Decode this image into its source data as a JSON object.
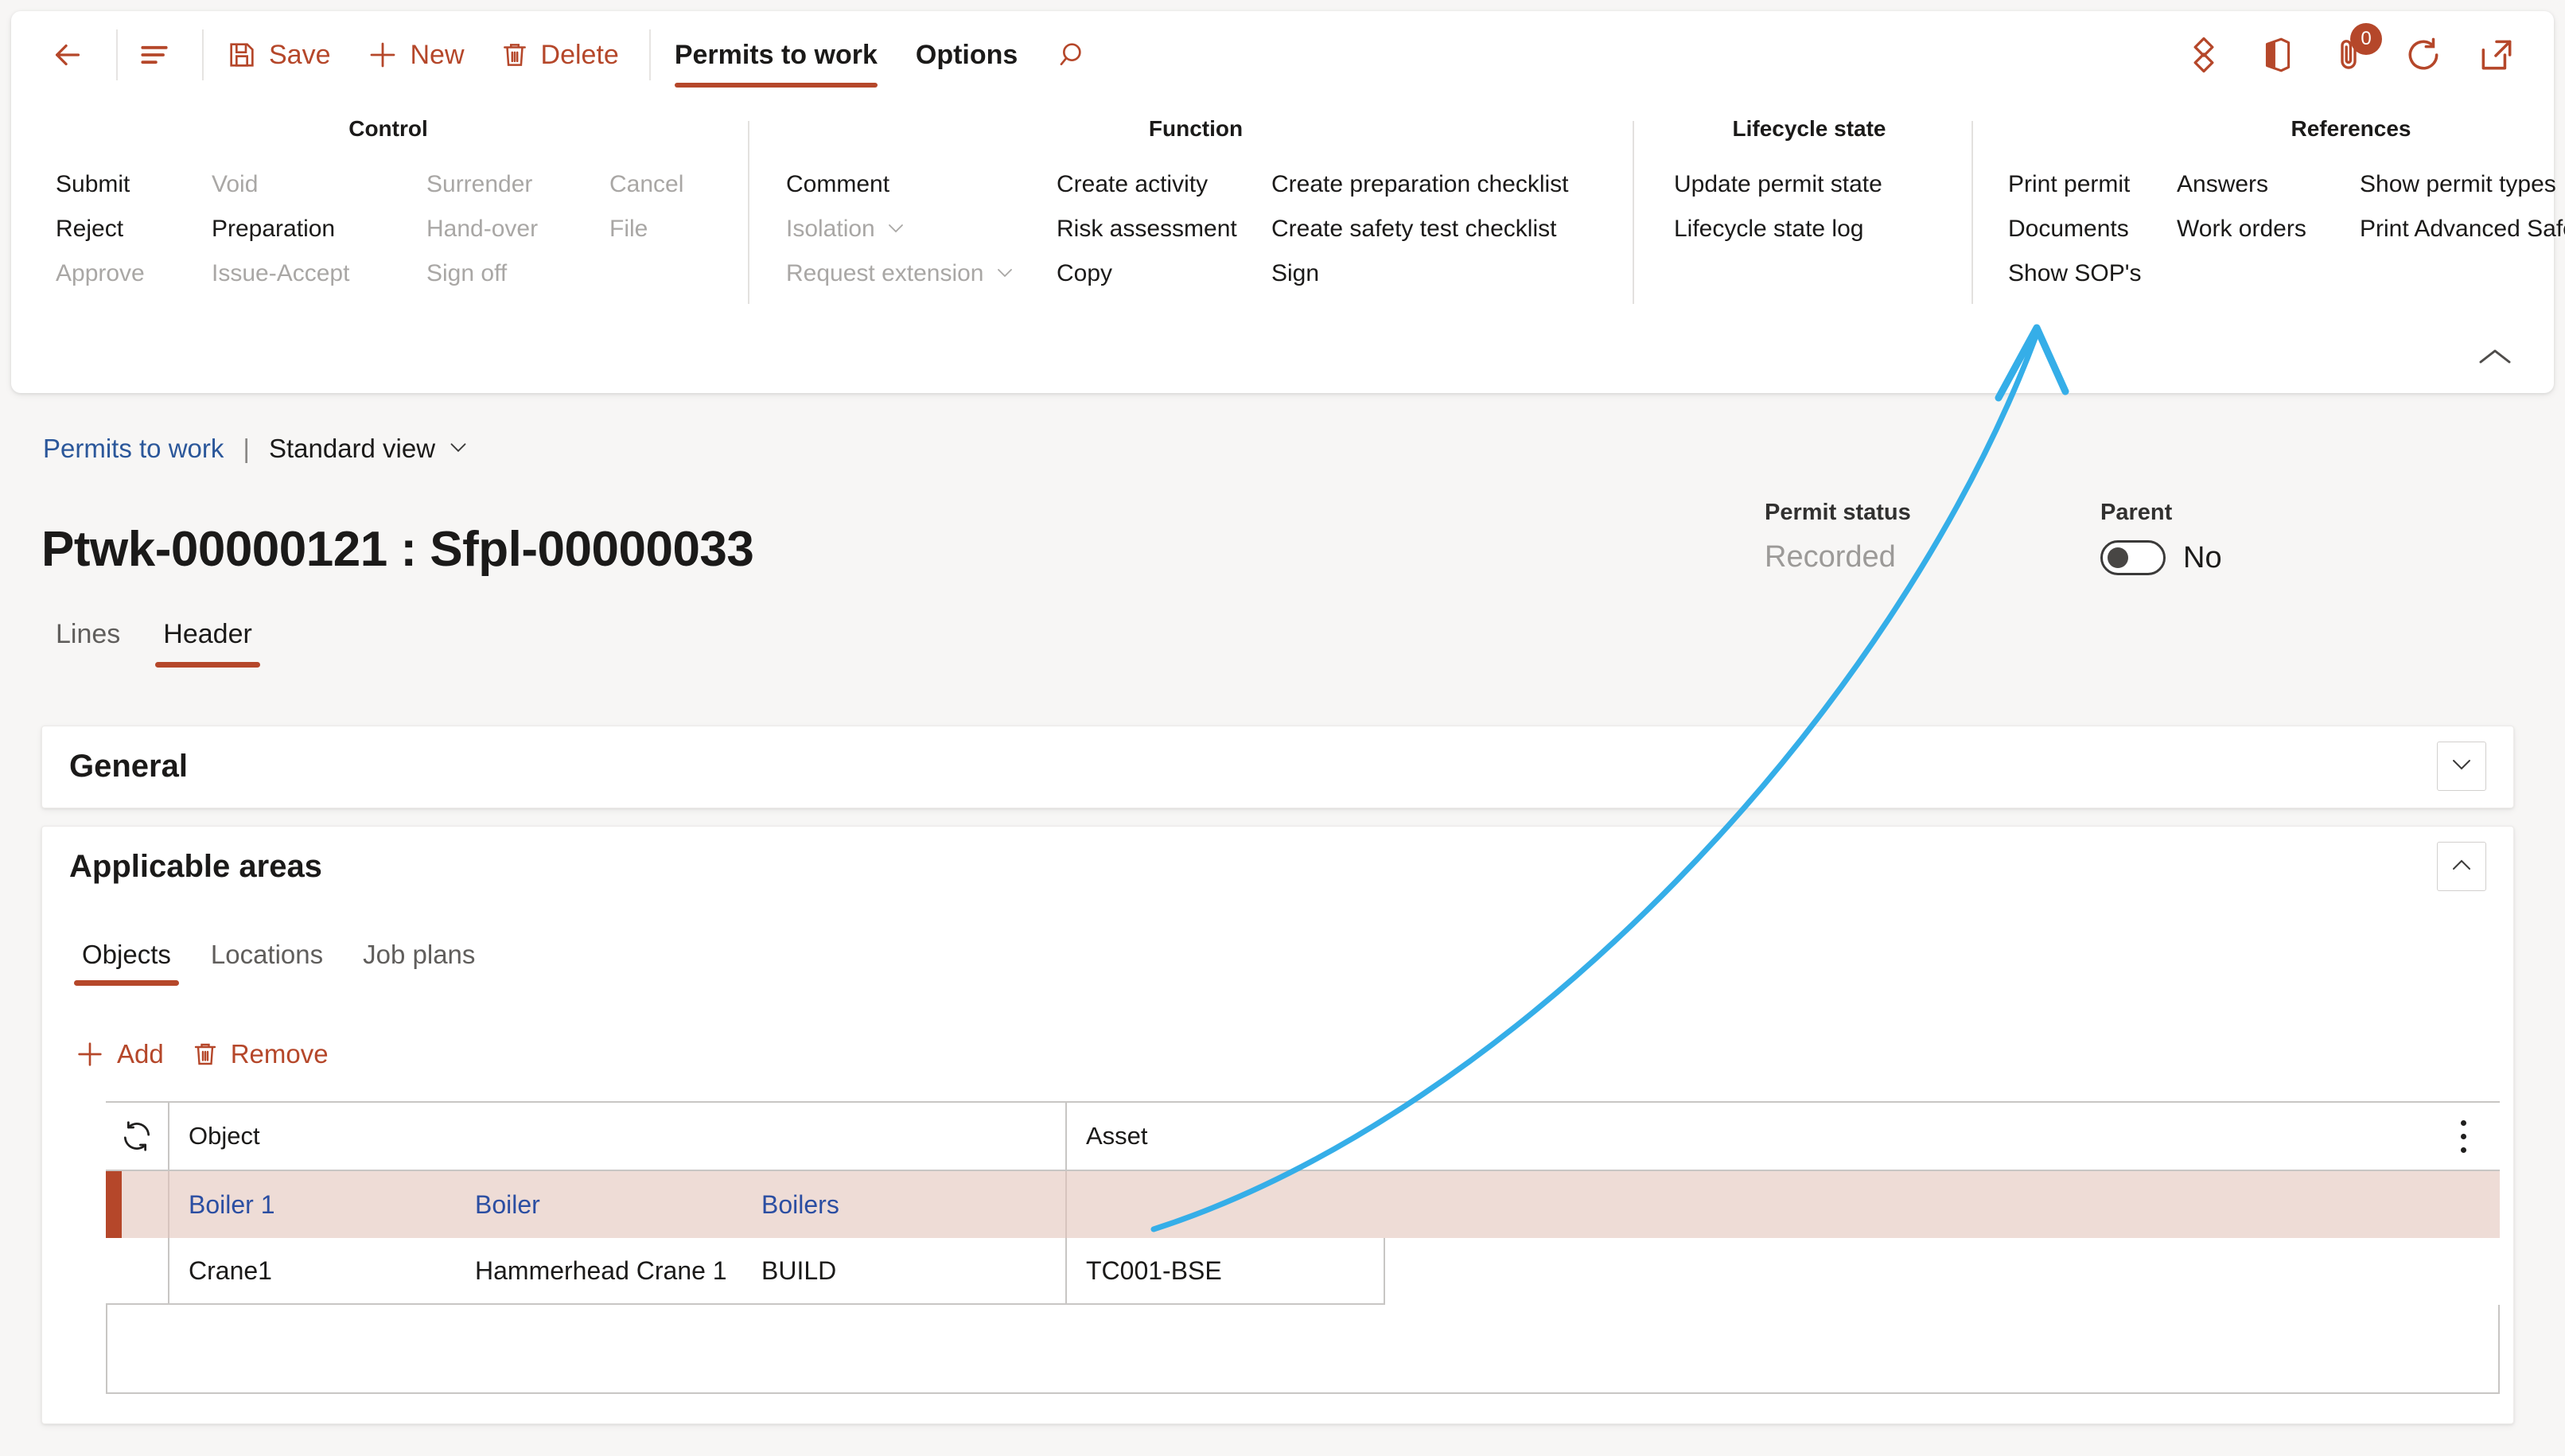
{
  "commandbar": {
    "back_label": "Back",
    "nav_label": "Show list",
    "buttons": [
      {
        "label": "Save",
        "icon": "save-icon"
      },
      {
        "label": "New",
        "icon": "plus-icon"
      },
      {
        "label": "Delete",
        "icon": "trash-icon"
      }
    ],
    "tabs": [
      {
        "label": "Permits to work",
        "active": true
      },
      {
        "label": "Options",
        "active": false
      }
    ],
    "search_label": "Search",
    "right_icons": [
      {
        "name": "power-bi-icon",
        "label": "Power BI"
      },
      {
        "name": "office-icon",
        "label": "Open in Microsoft Office"
      },
      {
        "name": "attachment-icon",
        "label": "Attachments",
        "badge": "0"
      },
      {
        "name": "refresh-icon",
        "label": "Refresh"
      },
      {
        "name": "open-in-new-icon",
        "label": "Open in new window"
      }
    ]
  },
  "ribbon": {
    "collapse_label": "Collapse the ribbon",
    "groups": [
      {
        "title": "Control",
        "columns": [
          [
            {
              "label": "Submit",
              "disabled": false
            },
            {
              "label": "Reject",
              "disabled": false
            },
            {
              "label": "Approve",
              "disabled": true
            }
          ],
          [
            {
              "label": "Void",
              "disabled": true
            },
            {
              "label": "Preparation",
              "disabled": false
            },
            {
              "label": "Issue-Accept",
              "disabled": true
            }
          ],
          [
            {
              "label": "Surrender",
              "disabled": true
            },
            {
              "label": "Hand-over",
              "disabled": true
            },
            {
              "label": "Sign off",
              "disabled": true
            }
          ],
          [
            {
              "label": "Cancel",
              "disabled": true
            },
            {
              "label": "File",
              "disabled": true
            }
          ]
        ]
      },
      {
        "title": "Function",
        "columns": [
          [
            {
              "label": "Comment",
              "disabled": false
            },
            {
              "label": "Isolation",
              "disabled": true,
              "chevron": true
            },
            {
              "label": "Request extension",
              "disabled": true,
              "chevron": true
            }
          ],
          [
            {
              "label": "Create activity",
              "disabled": false
            },
            {
              "label": "Risk assessment",
              "disabled": false
            },
            {
              "label": "Copy",
              "disabled": false
            }
          ],
          [
            {
              "label": "Create preparation checklist",
              "disabled": false
            },
            {
              "label": "Create safety test checklist",
              "disabled": false
            },
            {
              "label": "Sign",
              "disabled": false
            }
          ]
        ]
      },
      {
        "title": "Lifecycle state",
        "columns": [
          [
            {
              "label": "Update permit state",
              "disabled": false
            },
            {
              "label": "Lifecycle state log",
              "disabled": false
            }
          ]
        ]
      },
      {
        "title": "References",
        "columns": [
          [
            {
              "label": "Print permit",
              "disabled": false
            },
            {
              "label": "Documents",
              "disabled": false
            },
            {
              "label": "Show SOP's",
              "disabled": false
            }
          ],
          [
            {
              "label": "Answers",
              "disabled": false
            },
            {
              "label": "Work orders",
              "disabled": false
            }
          ],
          [
            {
              "label": "Show permit types",
              "disabled": false
            },
            {
              "label": "Print Advanced Safety Permit",
              "disabled": false
            }
          ]
        ]
      }
    ]
  },
  "breadcrumb": {
    "link": "Permits to work",
    "divider": "|",
    "view": "Standard view"
  },
  "page": {
    "title": "Ptwk-00000121 : Sfpl-00000033",
    "permit_status_label": "Permit status",
    "permit_status_value": "Recorded",
    "parent_label": "Parent",
    "parent_value": "No",
    "parent_toggle_state": "off"
  },
  "header_tabs": [
    {
      "label": "Lines",
      "active": false
    },
    {
      "label": "Header",
      "active": true
    }
  ],
  "sections": {
    "general": {
      "title": "General",
      "expanded": false
    },
    "applicable_areas": {
      "title": "Applicable areas",
      "expanded": true
    }
  },
  "subtabs": [
    {
      "label": "Objects",
      "active": true
    },
    {
      "label": "Locations",
      "active": false
    },
    {
      "label": "Job plans",
      "active": false
    }
  ],
  "grid_toolbar": [
    {
      "label": "Add",
      "icon": "plus-icon"
    },
    {
      "label": "Remove",
      "icon": "trash-icon"
    }
  ],
  "grid": {
    "refresh_label": "Refresh",
    "kebab_label": "More options",
    "columns": [
      {
        "label": "Object"
      },
      {
        "label": "Asset"
      }
    ],
    "rows": [
      {
        "selected": true,
        "object_id": "Boiler 1",
        "object_name": "Boiler",
        "object_type": "Boilers",
        "asset": "",
        "link": true
      },
      {
        "selected": false,
        "object_id": "Crane1",
        "object_name": "Hammerhead Crane 1",
        "object_type": "BUILD",
        "asset": "TC001-BSE",
        "link": false
      }
    ]
  },
  "annotation": {
    "type": "arrow",
    "color": "#35AEE8",
    "points_to": "Work orders",
    "starts_at": "selected-grid-row"
  },
  "colors": {
    "accent": "#B5472A",
    "link": "#2B579A",
    "grid_link": "#2B4EA2",
    "selected_row": "#EEDCD6",
    "page_bg": "#F7F6F5",
    "annotation": "#35AEE8"
  }
}
